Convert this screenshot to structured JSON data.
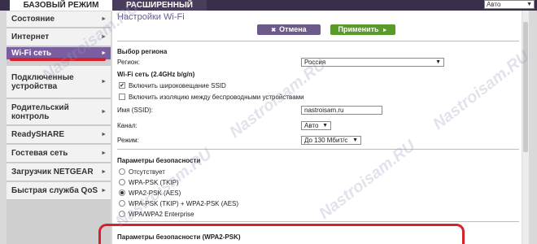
{
  "tabs": {
    "basic": "БАЗОВЫЙ РЕЖИМ",
    "advanced": "РАСШИРЕННЫЙ"
  },
  "language": {
    "value": "Авто"
  },
  "sidebar": {
    "items": [
      {
        "label": "Состояние"
      },
      {
        "label": "Интернет"
      },
      {
        "label": "Wi-Fi сеть"
      },
      {
        "label": "Подключенные устройства"
      },
      {
        "label": "Родительский контроль"
      },
      {
        "label": "ReadySHARE"
      },
      {
        "label": "Гостевая сеть"
      },
      {
        "label": "Загрузчик NETGEAR"
      },
      {
        "label": "Быстрая служба QoS"
      }
    ]
  },
  "main": {
    "title": "Настройки Wi-Fi",
    "cancel_label": "Отмена",
    "apply_label": "Применить",
    "region": {
      "heading": "Выбор региона",
      "label": "Регион:",
      "value": "Россия"
    },
    "wifi": {
      "heading": "Wi-Fi сеть (2.4GHz b/g/n)",
      "ssid_broadcast": "Включить широковещание SSID",
      "isolation": "Включить изоляцию между беспроводными устройствами",
      "ssid_label": "Имя (SSID):",
      "ssid_value": "nastroisam.ru",
      "channel_label": "Канал:",
      "channel_value": "Авто",
      "mode_label": "Режим:",
      "mode_value": "До 130 Мбит/с"
    },
    "security": {
      "heading": "Параметры безопасности",
      "options": [
        "Отсутствует",
        "WPA-PSK (TKIP)",
        "WPA2-PSK (AES)",
        "WPA-PSK (TKIP) + WPA2-PSK (AES)",
        "WPA/WPA2 Enterprise"
      ],
      "selected": "WPA2-PSK (AES)"
    },
    "security_wpa2": {
      "heading": "Параметры безопасности (WPA2-PSK)"
    }
  },
  "watermark": "Nastroisam.RU",
  "colors": {
    "accent": "#7b5ea0",
    "apply": "#5a9a2a",
    "highlight": "#d6202a"
  }
}
